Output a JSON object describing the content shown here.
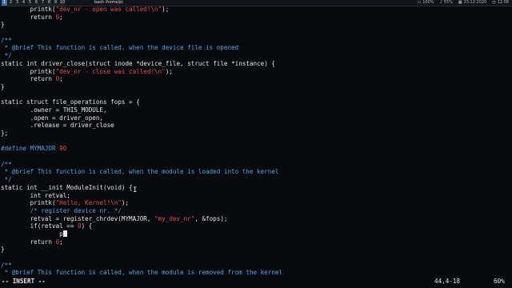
{
  "topbar": {
    "workspaces": [
      "1",
      "2",
      "3",
      "4",
      "5",
      "6",
      "7",
      "8",
      "9",
      "10"
    ],
    "active_workspace": 0,
    "window_title": "bash /home/pi",
    "status": {
      "zoom": "100%",
      "volume": "55%",
      "date": "23.12.2020",
      "time": "12:08"
    }
  },
  "editor": {
    "lines": [
      [
        [
          "plain",
          "        printk("
        ],
        [
          "str",
          "\"dev_nr - open was called!\\n\""
        ],
        [
          "plain",
          ");"
        ]
      ],
      [
        [
          "plain",
          "        "
        ],
        [
          "kw",
          "return"
        ],
        [
          "plain",
          " "
        ],
        [
          "num",
          "0"
        ],
        [
          "plain",
          ";"
        ]
      ],
      [
        [
          "plain",
          "}"
        ]
      ],
      [
        [
          "plain",
          ""
        ]
      ],
      [
        [
          "cm",
          "/**"
        ]
      ],
      [
        [
          "cm",
          " * @brief This function is called, when the device file is opened"
        ]
      ],
      [
        [
          "cm",
          " */"
        ]
      ],
      [
        [
          "kw",
          "static"
        ],
        [
          "plain",
          " "
        ],
        [
          "kw",
          "int"
        ],
        [
          "plain",
          " driver_close("
        ],
        [
          "kw",
          "struct"
        ],
        [
          "plain",
          " inode *device_file, "
        ],
        [
          "kw",
          "struct"
        ],
        [
          "plain",
          " file *instance) {"
        ]
      ],
      [
        [
          "plain",
          "        printk("
        ],
        [
          "str",
          "\"dev_nr - close was called!\\n\""
        ],
        [
          "plain",
          ");"
        ]
      ],
      [
        [
          "plain",
          "        "
        ],
        [
          "kw",
          "return"
        ],
        [
          "plain",
          " "
        ],
        [
          "num",
          "0"
        ],
        [
          "plain",
          ";"
        ]
      ],
      [
        [
          "plain",
          "}"
        ]
      ],
      [
        [
          "plain",
          ""
        ]
      ],
      [
        [
          "kw",
          "static"
        ],
        [
          "plain",
          " "
        ],
        [
          "kw",
          "struct"
        ],
        [
          "plain",
          " file_operations fops = {"
        ]
      ],
      [
        [
          "plain",
          "        .owner = THIS_MODULE,"
        ]
      ],
      [
        [
          "plain",
          "        .open = driver_open,"
        ]
      ],
      [
        [
          "plain",
          "        .release = driver_close"
        ]
      ],
      [
        [
          "plain",
          "};"
        ]
      ],
      [
        [
          "plain",
          ""
        ]
      ],
      [
        [
          "pp",
          "#define MYMAJOR "
        ],
        [
          "num",
          "90"
        ]
      ],
      [
        [
          "plain",
          ""
        ]
      ],
      [
        [
          "cm",
          "/**"
        ]
      ],
      [
        [
          "cm",
          " * @brief This function is called, when the module is loaded into the kernel"
        ]
      ],
      [
        [
          "cm",
          " */"
        ]
      ],
      [
        [
          "kw",
          "static"
        ],
        [
          "plain",
          " "
        ],
        [
          "kw",
          "int"
        ],
        [
          "plain",
          " __init ModuleInit("
        ],
        [
          "kw",
          "void"
        ],
        [
          "plain",
          ") {"
        ]
      ],
      [
        [
          "plain",
          "        "
        ],
        [
          "kw",
          "int"
        ],
        [
          "plain",
          " retval;"
        ]
      ],
      [
        [
          "plain",
          "        printk("
        ],
        [
          "str",
          "\"Hello, Kernel!\\n\""
        ],
        [
          "plain",
          ");"
        ]
      ],
      [
        [
          "plain",
          "        "
        ],
        [
          "cm",
          "/* register device nr. */"
        ]
      ],
      [
        [
          "plain",
          "        retval = register_chrdev(MYMAJOR, "
        ],
        [
          "str",
          "\"my_dev_nr\""
        ],
        [
          "plain",
          ", &fops);"
        ]
      ],
      [
        [
          "plain",
          "        "
        ],
        [
          "kw",
          "if"
        ],
        [
          "plain",
          "(retval == "
        ],
        [
          "num",
          "0"
        ],
        [
          "plain",
          ") {"
        ]
      ],
      [
        [
          "plain",
          "                p"
        ],
        [
          "cursor",
          ""
        ]
      ],
      [
        [
          "plain",
          "        "
        ],
        [
          "kw",
          "return"
        ],
        [
          "plain",
          " "
        ],
        [
          "num",
          "0"
        ],
        [
          "plain",
          ";"
        ]
      ],
      [
        [
          "plain",
          "}"
        ]
      ],
      [
        [
          "plain",
          ""
        ]
      ],
      [
        [
          "cm",
          "/**"
        ]
      ],
      [
        [
          "cm",
          " * @brief This function is called, when the module is removed from the kernel"
        ]
      ]
    ]
  },
  "statusline": {
    "mode": "-- INSERT --",
    "position": "44,4-18",
    "percent": "60%"
  }
}
